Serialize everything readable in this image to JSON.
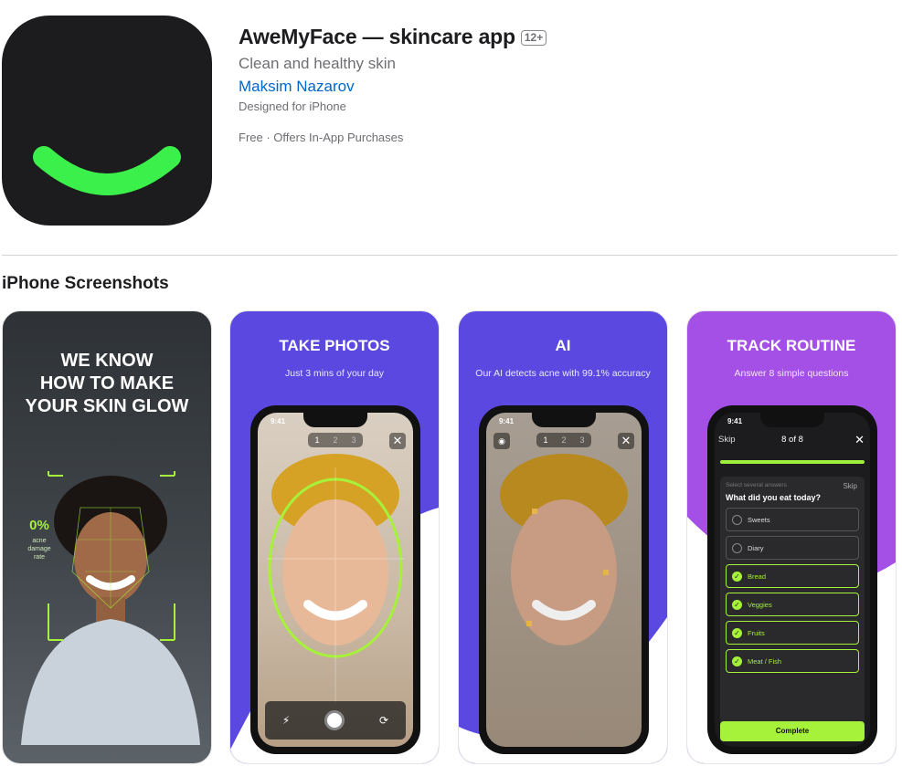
{
  "app": {
    "title": "AweMyFace — skincare app",
    "age_rating": "12+",
    "subtitle": "Clean and healthy skin",
    "developer": "Maksim Nazarov",
    "designed_for": "Designed for iPhone",
    "price": "Free · Offers In-App Purchases",
    "icon": "smile-logo-icon",
    "colors": {
      "icon_bg": "#1c1c1e",
      "accent_green": "#3cf04b",
      "link": "#0066cc"
    }
  },
  "section": {
    "title": "iPhone Screenshots"
  },
  "screenshots": [
    {
      "headline": "WE KNOW\nHOW TO MAKE\nYOUR SKIN GLOW",
      "stat_value": "0%",
      "stat_label": "acne\ndamage\nrate"
    },
    {
      "headline": "TAKE PHOTOS",
      "sub": "Just 3 mins of your day",
      "time": "9:41",
      "tabs": [
        "1",
        "2",
        "3"
      ]
    },
    {
      "headline": "AI",
      "sub": "Our AI detects acne with 99.1% accuracy",
      "time": "9:41",
      "tabs": [
        "1",
        "2",
        "3"
      ]
    },
    {
      "headline": "TRACK ROUTINE",
      "sub": "Answer 8 simple questions",
      "time": "9:41",
      "skip": "Skip",
      "progress": "8 of 8",
      "hint": "Select several answers",
      "question": "What did you eat today?",
      "options": [
        "Sweets",
        "Diary",
        "Bread",
        "Veggies",
        "Fruits",
        "Meat / Fish"
      ],
      "selected": [
        false,
        false,
        true,
        true,
        true,
        true
      ],
      "complete": "Complete"
    }
  ]
}
